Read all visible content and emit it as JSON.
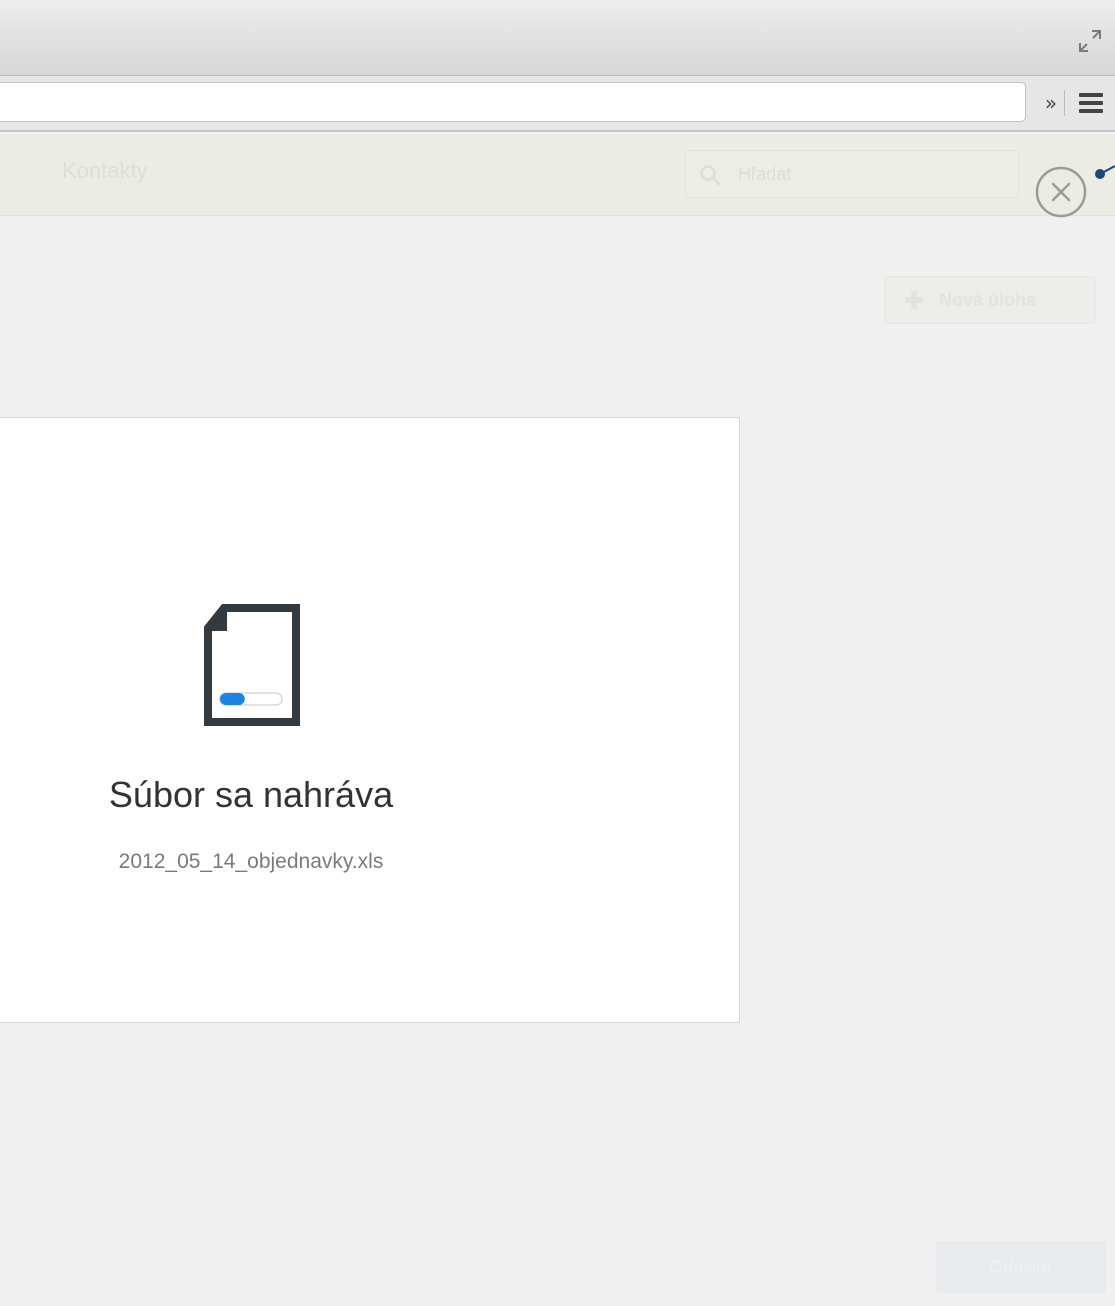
{
  "browser": {
    "address_value": "",
    "more_label": "»",
    "icons": {
      "fullscreen": "fullscreen-icon",
      "menu": "menu-icon"
    }
  },
  "app": {
    "nav": {
      "items": [
        "Kontakty"
      ]
    },
    "search": {
      "placeholder": "Hľadať"
    },
    "new_task_label": "Nová úloha",
    "bottom_button_label": "Odoslať"
  },
  "overlay": {
    "close_icon": "close-icon"
  },
  "upload": {
    "title": "Súbor sa nahráva",
    "filename": "2012_05_14_objednavky.xls",
    "progress": 0.4
  },
  "colors": {
    "accent": "#1a84e6",
    "icon_dark": "#333a40",
    "annotation": "#1a4a7a"
  }
}
